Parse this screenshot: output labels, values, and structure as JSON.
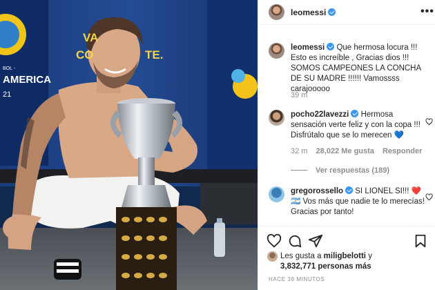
{
  "post": {
    "username": "leomessi",
    "more_glyph": "•••",
    "photo_wall_text": "VAMO CO PEONES. TE.",
    "photo_wall_left_text": "AMERICA",
    "photo_wall_left_small": "BOL -",
    "photo_wall_left_num": "21"
  },
  "caption": {
    "username": "leomessi",
    "text": "Que hermosa locura !!! Esto es increíble , Gracias dios !!! SOMOS CAMPEONES LA CONCHA DE SU MADRE !!!!!! Vamossss carajooooo",
    "time": "39 m"
  },
  "comments": [
    {
      "username": "pocho22lavezzi",
      "text_before": "Hermosa sensación verte feliz y con la copa !!! Disfrútalo que se lo merecen ",
      "emoji": "💙",
      "time": "32 m",
      "likes": "28,022 Me gusta",
      "reply_label": "Responder",
      "view_replies": "Ver respuestas (189)"
    },
    {
      "username": "gregorossello",
      "text_before": "SI LIONEL SI!!! ",
      "emoji": "❤️",
      "flag": "🇦🇷",
      "text_after": " Vos más que nadie te lo merecías! Gracias por tanto!"
    }
  ],
  "likes": {
    "prefix": "Les gusta a ",
    "user": "miligbelotti",
    "joiner": " y",
    "count": "3,832,771 personas más"
  },
  "timestamp": "HACE 39 MINUTOS",
  "colors": {
    "verified": "#3897f0",
    "meta_gray": "#8e8e8e",
    "heart_red": "#ed4956"
  },
  "icons": [
    "heart-icon",
    "comment-icon",
    "share-icon",
    "save-icon",
    "more-options-icon",
    "verified-icon"
  ]
}
